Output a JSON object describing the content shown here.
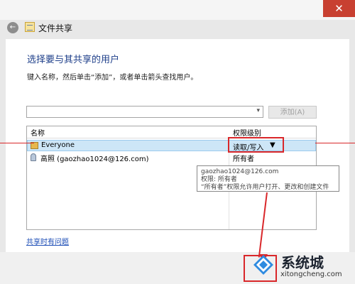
{
  "window": {
    "title": "文件共享",
    "close_glyph": "✕",
    "back_glyph": "←"
  },
  "main": {
    "heading": "选择要与其共享的用户",
    "instruction": "键入名称，然后单击“添加”，或者单击箭头查找用户。",
    "input": {
      "value": "",
      "dropdown_glyph": "▾"
    },
    "add_button": "添加(A)"
  },
  "list": {
    "columns": {
      "name": "名称",
      "level": "权限级别"
    },
    "rows": [
      {
        "name": "Everyone",
        "level": "读取/写入",
        "caret": "▼"
      },
      {
        "name": "高照 (gaozhao1024@126.com)",
        "level": "所有者"
      }
    ]
  },
  "tooltip": {
    "line1": "gaozhao1024@126.com",
    "line2": "权限: 所有者",
    "line3": "“所有者”权限允许用户打开、更改和创建文件"
  },
  "footer": {
    "help_link": "共享时有问题"
  },
  "watermark": {
    "title": "系统城",
    "domain": "xitongcheng.com"
  },
  "colors": {
    "heading": "#1e3f8a",
    "link": "#1a4bb5",
    "annotation": "#d9272a",
    "close": "#c84031"
  },
  "icons": [
    "back-arrow-icon",
    "share-folder-icon",
    "dropdown-arrow-icon",
    "group-icon",
    "user-icon",
    "watermark-logo-icon"
  ]
}
